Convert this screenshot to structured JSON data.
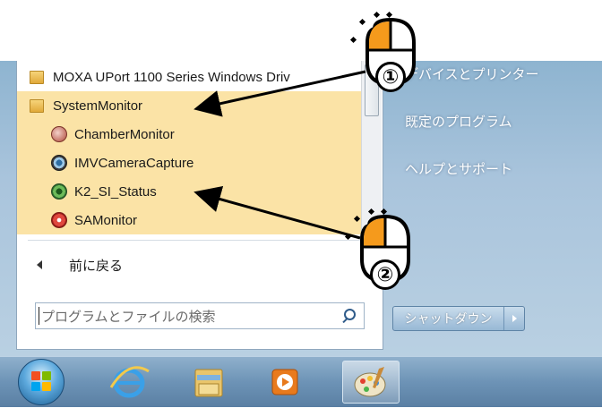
{
  "start_menu": {
    "programs": [
      {
        "label": "MOXA UPort 1100 Series Windows Driv",
        "icon": "folder-icon",
        "highlighted": false
      },
      {
        "label": "SystemMonitor",
        "icon": "folder-icon",
        "highlighted": true
      },
      {
        "label": "ChamberMonitor",
        "icon": "chamber-monitor-icon",
        "highlighted": true
      },
      {
        "label": "IMVCameraCapture",
        "icon": "camera-capture-icon",
        "highlighted": true
      },
      {
        "label": "K2_SI_Status",
        "icon": "k2-status-icon",
        "highlighted": true
      },
      {
        "label": "SAMonitor",
        "icon": "sa-monitor-icon",
        "highlighted": true
      }
    ],
    "back_label": "前に戻る",
    "search": {
      "placeholder": "プログラムとファイルの検索"
    },
    "right_items": [
      "デバイスとプリンター",
      "既定のプログラム",
      "ヘルプとサポート"
    ],
    "shutdown_label": "シャットダウン"
  },
  "annotations": {
    "step1": "①",
    "step2": "②"
  },
  "taskbar": {
    "items": [
      "start-button",
      "internet-explorer-icon",
      "file-explorer-icon",
      "media-player-icon",
      "paint-icon"
    ]
  },
  "colors": {
    "highlight": "#fbe3a6",
    "mouse_button_active": "#f59a1c",
    "taskbar": "#6d93b6"
  }
}
